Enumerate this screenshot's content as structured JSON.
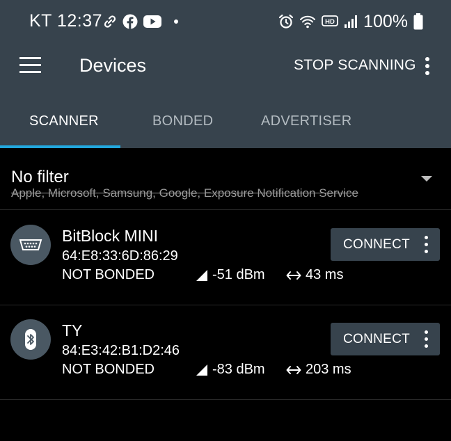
{
  "status_bar": {
    "carrier_time": "KT 12:37",
    "battery_pct": "100%",
    "icons_left": [
      "link-icon",
      "facebook-icon",
      "youtube-icon",
      "dot-icon"
    ],
    "icons_right": [
      "alarm-icon",
      "wifi-icon",
      "hd-icon",
      "signal-icon",
      "battery-icon"
    ]
  },
  "app_bar": {
    "title": "Devices",
    "action_label": "STOP SCANNING"
  },
  "tabs": [
    {
      "label": "SCANNER",
      "active": true
    },
    {
      "label": "BONDED",
      "active": false
    },
    {
      "label": "ADVERTISER",
      "active": false
    }
  ],
  "filter": {
    "title": "No filter",
    "subtitle": "Apple, Microsoft, Samsung, Google, Exposure Notification Service"
  },
  "devices": [
    {
      "name": "BitBlock MINI",
      "address": "64:E8:33:6D:86:29",
      "bond_state": "NOT BONDED",
      "rssi": "-51 dBm",
      "interval": "43 ms",
      "icon": "serial-port-icon",
      "connect_label": "CONNECT"
    },
    {
      "name": "TY",
      "address": "84:E3:42:B1:D2:46",
      "bond_state": "NOT BONDED",
      "rssi": "-83 dBm",
      "interval": "203 ms",
      "icon": "bluetooth-icon",
      "connect_label": "CONNECT"
    }
  ],
  "colors": {
    "toolbar_bg": "#37434d",
    "tab_indicator": "#22a8de",
    "background": "#000000",
    "icon_circle": "#4a5863"
  }
}
